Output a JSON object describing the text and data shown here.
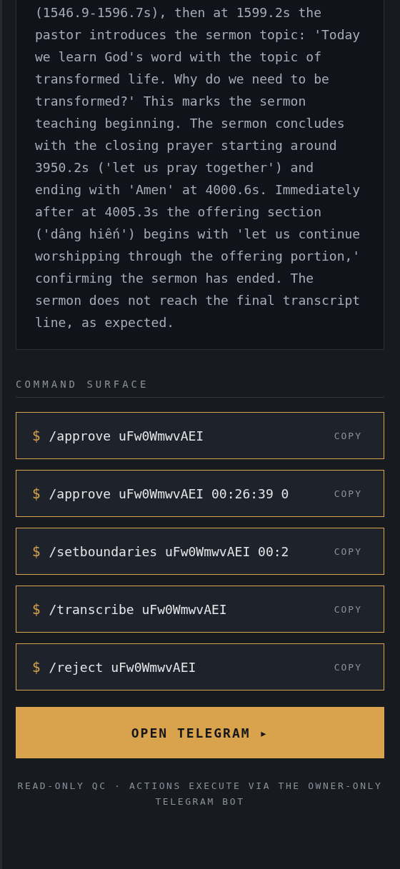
{
  "summary": {
    "text": "(1546.9-1596.7s), then at 1599.2s the pastor introduces the sermon topic: 'Today we learn God's word with the topic of transformed life. Why do we need to be transformed?' This marks the sermon teaching beginning. The sermon concludes with the closing prayer starting around 3950.2s ('let us pray together') and ending with 'Amen' at 4000.6s. Immediately after at 4005.3s the offering section ('dâng hiến') begins with 'let us continue worshipping through the offering portion,' confirming the sermon has ended. The sermon does not reach the final transcript line, as expected."
  },
  "command_surface": {
    "title": "COMMAND SURFACE",
    "commands": [
      {
        "prompt": "$",
        "command": "/approve uFw0WmwvAEI",
        "action": "COPY"
      },
      {
        "prompt": "$",
        "command": "/approve uFw0WmwvAEI 00:26:39 0",
        "action": "COPY"
      },
      {
        "prompt": "$",
        "command": "/setboundaries uFw0WmwvAEI 00:2",
        "action": "COPY"
      },
      {
        "prompt": "$",
        "command": "/transcribe uFw0WmwvAEI",
        "action": "COPY"
      },
      {
        "prompt": "$",
        "command": "/reject uFw0WmwvAEI",
        "action": "COPY"
      }
    ]
  },
  "open_button": {
    "label": "OPEN TELEGRAM ▸"
  },
  "footer": "READ-ONLY QC · ACTIONS EXECUTE VIA THE OWNER-ONLY TELEGRAM BOT"
}
